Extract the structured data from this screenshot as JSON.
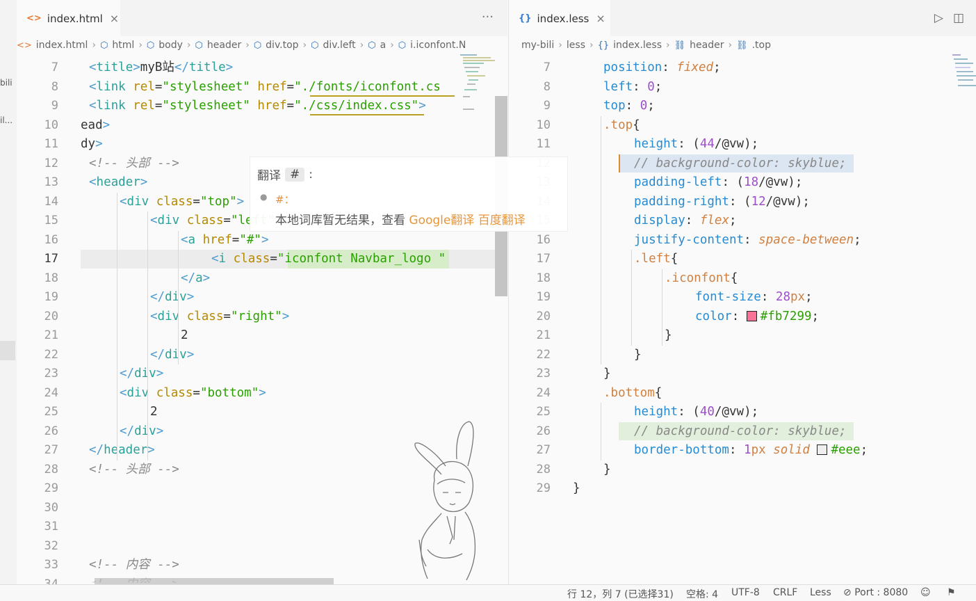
{
  "sidebar": {
    "text1": "bili",
    "text2": "il..."
  },
  "left_editor": {
    "tab": {
      "icon": "<>",
      "label": "index.html",
      "close": "×"
    },
    "more": "···",
    "breadcrumb": [
      "index.html",
      "html",
      "body",
      "header",
      "div.top",
      "div.left",
      "a",
      "i.iconfont.N"
    ],
    "lines": [
      {
        "n": "7",
        "t": "<title>myB站</title>"
      },
      {
        "n": "8",
        "t": "<link rel=\"stylesheet\" href=\"./fonts/iconfont.cs"
      },
      {
        "n": "9",
        "t": "<link rel=\"stylesheet\" href=\"./css/index.css\">"
      },
      {
        "n": "10",
        "t": "ead>"
      },
      {
        "n": "11",
        "t": "dy>"
      },
      {
        "n": "12",
        "t": "<!-- 头部 -->"
      },
      {
        "n": "13",
        "t": "<header>"
      },
      {
        "n": "14",
        "t": "<div class=\"top\">"
      },
      {
        "n": "15",
        "t": "<div class=\"left\">"
      },
      {
        "n": "16",
        "t": "<a href=\"#\">"
      },
      {
        "n": "17",
        "t": "<i class=\"iconfont Navbar_logo \""
      },
      {
        "n": "18",
        "t": "</a>"
      },
      {
        "n": "19",
        "t": "</div>"
      },
      {
        "n": "20",
        "t": "<div class=\"right\">"
      },
      {
        "n": "21",
        "t": "2"
      },
      {
        "n": "22",
        "t": "</div>"
      },
      {
        "n": "23",
        "t": "</div>"
      },
      {
        "n": "24",
        "t": "<div class=\"bottom\">"
      },
      {
        "n": "25",
        "t": "2"
      },
      {
        "n": "26",
        "t": "</div>"
      },
      {
        "n": "27",
        "t": "</header>"
      },
      {
        "n": "28",
        "t": "<!-- 头部 -->"
      },
      {
        "n": "29",
        "t": ""
      },
      {
        "n": "30",
        "t": ""
      },
      {
        "n": "31",
        "t": ""
      },
      {
        "n": "32",
        "t": ""
      },
      {
        "n": "33",
        "t": "<!-- 内容 -->"
      },
      {
        "n": "34",
        "t": "<!-- 内容 -->"
      }
    ]
  },
  "hover": {
    "title": "翻译",
    "key": "#",
    "colon": ":",
    "item": "#：",
    "result": "本地词库暂无结果，查看",
    "google": "Google翻译",
    "baidu": "百度翻译"
  },
  "right_editor": {
    "tab": {
      "icon": "{}",
      "label": "index.less",
      "close": "×"
    },
    "breadcrumb": [
      "my-bili",
      "less",
      "index.less",
      "header",
      ".top"
    ],
    "lines": [
      {
        "n": "7",
        "t": "position: fixed;"
      },
      {
        "n": "8",
        "t": "left: 0;"
      },
      {
        "n": "9",
        "t": "top: 0;"
      },
      {
        "n": "10",
        "t": ".top{"
      },
      {
        "n": "11",
        "t": "height: (44/@vw);"
      },
      {
        "n": "12",
        "t": "// background-color: skyblue;"
      },
      {
        "n": "13",
        "t": "padding-left: (18/@vw);"
      },
      {
        "n": "14",
        "t": "padding-right: (12/@vw);"
      },
      {
        "n": "15",
        "t": "display: flex;"
      },
      {
        "n": "16",
        "t": "justify-content: space-between;"
      },
      {
        "n": "17",
        "t": ".left{"
      },
      {
        "n": "18",
        "t": ".iconfont{"
      },
      {
        "n": "19",
        "t": "font-size: 28px;"
      },
      {
        "n": "20",
        "t": "color: #fb7299;"
      },
      {
        "n": "21",
        "t": "}"
      },
      {
        "n": "22",
        "t": "}"
      },
      {
        "n": "23",
        "t": "}"
      },
      {
        "n": "24",
        "t": ".bottom{"
      },
      {
        "n": "25",
        "t": "height: (40/@vw);"
      },
      {
        "n": "26",
        "t": "// background-color: skyblue;"
      },
      {
        "n": "27",
        "t": "border-bottom: 1px solid #eee;"
      },
      {
        "n": "28",
        "t": "}"
      },
      {
        "n": "29",
        "t": "}"
      }
    ],
    "swatch_pink": "#fb7299",
    "swatch_eee": "#eeeeee"
  },
  "status": {
    "position": "行 12，列 7 (已选择31)",
    "spaces": "空格: 4",
    "encoding": "UTF-8",
    "eol": "CRLF",
    "language": "Less",
    "port": "Port : 8080"
  }
}
